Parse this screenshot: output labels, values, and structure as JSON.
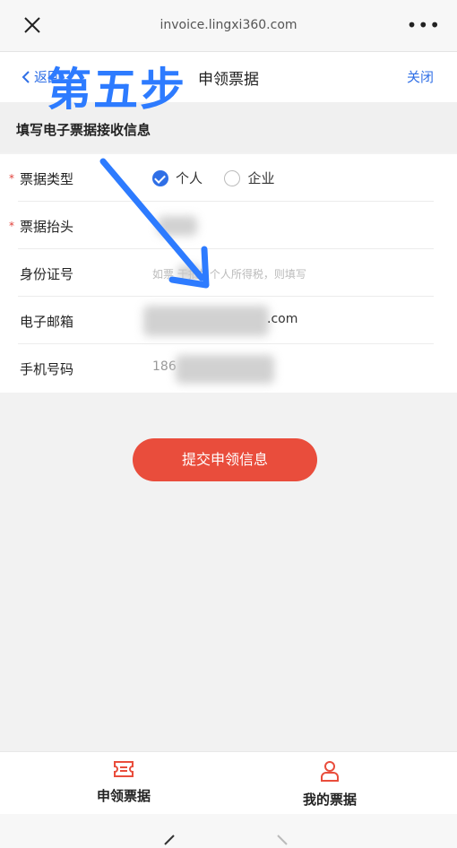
{
  "browser": {
    "url": "invoice.lingxi360.com",
    "more": "•••"
  },
  "nav": {
    "back_label": "返回",
    "title": "申领票据",
    "close_label": "关闭"
  },
  "overlay": {
    "step_text": "第五步"
  },
  "section": {
    "title": "填写电子票据接收信息"
  },
  "form": {
    "type_label": "票据类型",
    "type_options": [
      "个人",
      "企业"
    ],
    "type_selected": "个人",
    "header_label": "票据抬头",
    "id_label": "身份证号",
    "id_placeholder": "如票据用于抵扣个人所得税，则填写",
    "id_placeholder_visible": "如票    于抵扣个人所得税，则填写",
    "email_label": "电子邮箱",
    "email_visible": ".com",
    "phone_label": "手机号码",
    "phone_visible": "186",
    "required_mark": "*"
  },
  "submit": {
    "label": "提交申领信息"
  },
  "tabs": [
    {
      "label": "申领票据",
      "icon": "ticket-icon",
      "color": "#e94d3c"
    },
    {
      "label": "我的票据",
      "icon": "user-icon",
      "color": "#e94d3c"
    }
  ],
  "colors": {
    "accent_blue": "#2f6fe6",
    "submit_red": "#e94d3c",
    "overlay_blue": "#2d7bff"
  }
}
